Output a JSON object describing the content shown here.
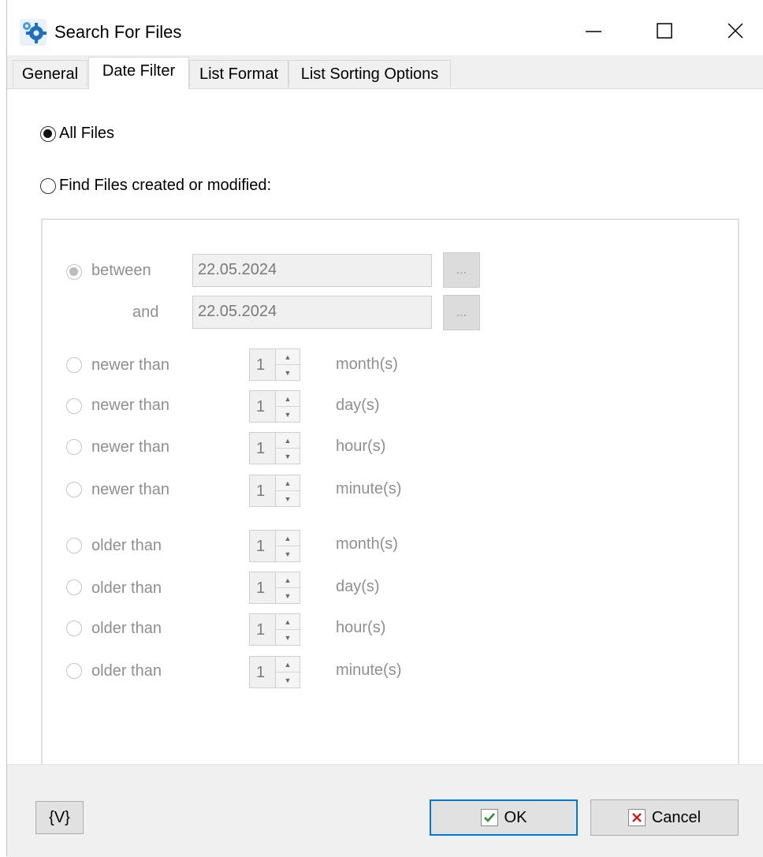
{
  "window": {
    "title": "Search For Files",
    "minimize_label": "—",
    "maximize_label": "☐",
    "close_label": "✕"
  },
  "tabs": [
    {
      "label": "General",
      "active": false
    },
    {
      "label": "Date Filter",
      "active": true
    },
    {
      "label": "List Format",
      "active": false
    },
    {
      "label": "List Sorting Options",
      "active": false
    }
  ],
  "mode": {
    "all_files_label": "All Files",
    "all_files_checked": true,
    "find_label": "Find Files created or modified:",
    "find_checked": false
  },
  "between": {
    "label": "between",
    "and_label": "and",
    "from": "22.05.2024",
    "to": "22.05.2024",
    "browse_label": "..."
  },
  "newer": [
    {
      "label": "newer than",
      "value": "1",
      "unit": "month(s)"
    },
    {
      "label": "newer than",
      "value": "1",
      "unit": "day(s)"
    },
    {
      "label": "newer than",
      "value": "1",
      "unit": "hour(s)"
    },
    {
      "label": "newer than",
      "value": "1",
      "unit": "minute(s)"
    }
  ],
  "older": [
    {
      "label": "older than",
      "value": "1",
      "unit": "month(s)"
    },
    {
      "label": "older than",
      "value": "1",
      "unit": "day(s)"
    },
    {
      "label": "older than",
      "value": "1",
      "unit": "hour(s)"
    },
    {
      "label": "older than",
      "value": "1",
      "unit": "minute(s)"
    }
  ],
  "footer": {
    "variables_label": "{V}",
    "ok_label": "OK",
    "cancel_label": "Cancel"
  },
  "colors": {
    "accent": "#0078d7",
    "ok_check": "#2e8b2e",
    "cancel_x": "#d01c1c"
  }
}
